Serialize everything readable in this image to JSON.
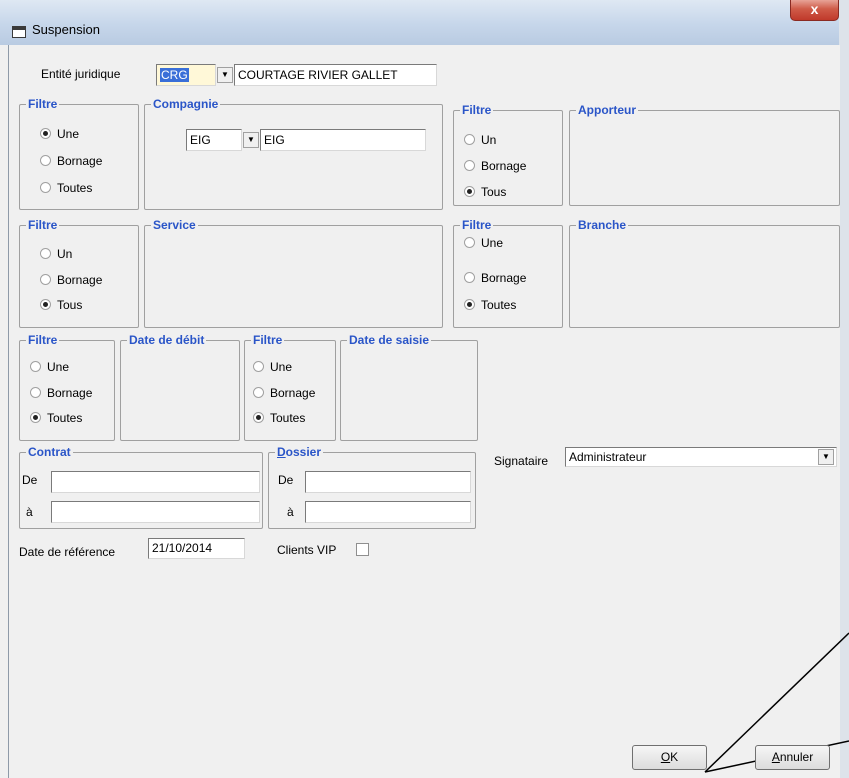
{
  "window": {
    "title": "Suspension",
    "close_glyph": "x"
  },
  "entite": {
    "label": "Entité juridique",
    "code": "CRG",
    "name": "COURTAGE RIVIER GALLET"
  },
  "filtre_compagnie": {
    "title": "Filtre",
    "options": [
      "Une",
      "Bornage",
      "Toutes"
    ],
    "selected": 0
  },
  "compagnie": {
    "title": "Compagnie",
    "code": "EIG",
    "name": "EIG"
  },
  "filtre_apporteur": {
    "title": "Filtre",
    "options": [
      "Un",
      "Bornage",
      "Tous"
    ],
    "selected": 2
  },
  "apporteur": {
    "title": "Apporteur"
  },
  "filtre_service": {
    "title": "Filtre",
    "options": [
      "Un",
      "Bornage",
      "Tous"
    ],
    "selected": 2
  },
  "service": {
    "title": "Service"
  },
  "filtre_branche": {
    "title": "Filtre",
    "options": [
      "Une",
      "Bornage",
      "Toutes"
    ],
    "selected": 2
  },
  "branche": {
    "title": "Branche"
  },
  "filtre_debit": {
    "title": "Filtre",
    "options": [
      "Une",
      "Bornage",
      "Toutes"
    ],
    "selected": 2
  },
  "date_debit": {
    "title": "Date de débit"
  },
  "filtre_saisie": {
    "title": "Filtre",
    "options": [
      "Une",
      "Bornage",
      "Toutes"
    ],
    "selected": 2
  },
  "date_saisie": {
    "title": "Date de saisie"
  },
  "contrat": {
    "title": "Contrat",
    "de_label": "De",
    "a_label": "à",
    "de_value": "",
    "a_value": ""
  },
  "dossier": {
    "title": "Dossier",
    "title_underline": "D",
    "title_rest": "ossier",
    "de_label": "De",
    "a_label": "à",
    "de_value": "",
    "a_value": ""
  },
  "signataire": {
    "label": "Signataire",
    "value": "Administrateur"
  },
  "date_reference": {
    "label": "Date de référence",
    "value": "21/10/2014"
  },
  "clients_vip": {
    "label": "Clients VIP",
    "checked": false
  },
  "buttons": {
    "ok_u": "O",
    "ok_rest": "K",
    "annuler_u": "A",
    "annuler_rest": "nnuler"
  },
  "icons": {
    "window": "window-icon",
    "dropdown": "chevron-down-icon"
  }
}
